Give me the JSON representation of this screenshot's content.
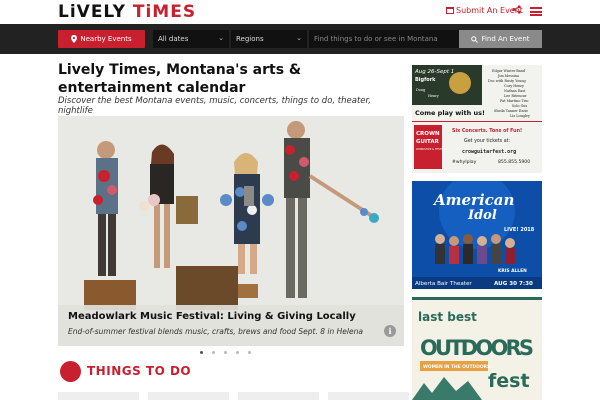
{
  "header": {
    "logo_part1": "LiVELY",
    "logo_part2": "TiMES",
    "submit_label": "Submit An Event"
  },
  "searchbar": {
    "nearby_label": "Nearby Events",
    "dates_value": "All dates",
    "regions_value": "Regions",
    "search_placeholder": "Find things to do or see in Montana",
    "find_label": "Find An Event"
  },
  "main": {
    "title": "Lively Times, Montana's arts & entertainment calendar",
    "subtitle": "Discover the best Montana events, music, concerts, things to do, theater, nightlife"
  },
  "hero": {
    "caption_title": "Meadowlark Music Festival: Living & Giving Locally",
    "caption_sub": "End-of-summer festival blends music, crafts, brews and food Sept. 8 in Helena",
    "slide_count": 5,
    "active_slide": 1
  },
  "things_to_do": {
    "title": "THINGS TO DO"
  },
  "ads": {
    "crown": {
      "dates": "Aug 26-Sept 1",
      "town": "Bigfork",
      "tagline": "Come play with us!",
      "brand_line1": "CROWN",
      "brand_line2": "GUITAR",
      "brand_line3": "WORKSHOP & FESTIVAL",
      "promo_line1": "Six Concerts. Tons of Fun!",
      "promo_line2": "Get your tickets at:",
      "site": "crowguitarfest.org",
      "hashtag": "#whyIplay",
      "phone": "855.855.5900",
      "artists": [
        "Edgar Winter Band",
        "Jim Messina",
        "Doc with Rusty Young",
        "Cory Henry",
        "Nathan East",
        "Doug",
        "Henry",
        "Lee Ritenour",
        "Pat Martino Trio",
        "Solo Gus",
        "Sheila Tanner Ezzie",
        "Liz Longley"
      ]
    },
    "idol": {
      "brand": "American",
      "brand2": "Idol",
      "live": "LIVE! 2018",
      "host": "KRIS ALLEN",
      "venue": "Alberta Bair Theater",
      "date": "AUG 30 7:30"
    },
    "outdoors": {
      "line1": "last best",
      "line2": "OUTDOORS",
      "line3": "fest",
      "tagline": "WOMEN IN THE OUTDOORS"
    }
  },
  "colors": {
    "brand_red": "#c8202e",
    "search_bg": "#222222",
    "idol_blue": "#0d4fa8"
  }
}
